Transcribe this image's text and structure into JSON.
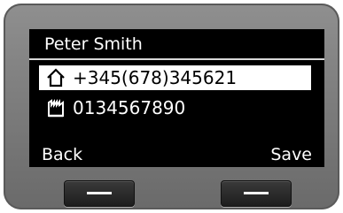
{
  "screen": {
    "title": "Peter Smith",
    "entries": [
      {
        "icon": "home-icon",
        "number": "+345(678)345621",
        "selected": true
      },
      {
        "icon": "office-icon",
        "number": "0134567890",
        "selected": false
      }
    ]
  },
  "softkeys": {
    "left_label": "Back",
    "right_label": "Save"
  },
  "colors": {
    "screen_bg": "#000000",
    "text": "#ffffff",
    "selection_bg": "#ffffff",
    "device_body": "#7a7a7a"
  }
}
